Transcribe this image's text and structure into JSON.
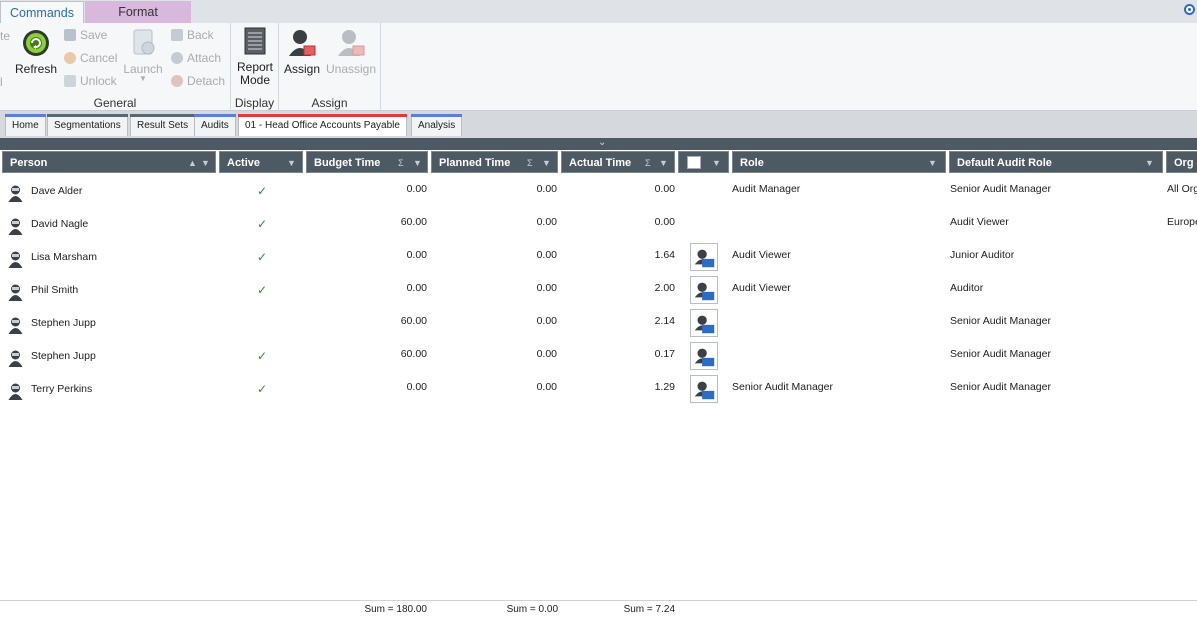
{
  "ribbon": {
    "tabs": [
      "Commands",
      "Format"
    ],
    "general": {
      "label": "General",
      "partial_left_top": "te",
      "partial_left_bottom": "l",
      "refresh": "Refresh",
      "save": "Save",
      "cancel": "Cancel",
      "unlock": "Unlock",
      "launch": "Launch",
      "back": "Back",
      "attach": "Attach",
      "detach": "Detach"
    },
    "display": {
      "label": "Display",
      "report_mode_1": "Report",
      "report_mode_2": "Mode"
    },
    "assign": {
      "label": "Assign",
      "assign": "Assign",
      "unassign": "Unassign"
    }
  },
  "doc_tabs": [
    {
      "label": "Home",
      "bar_color": "#5b7fd6"
    },
    {
      "label": "Segmentations",
      "bar_color": "#5a6670"
    },
    {
      "label": "Result Sets",
      "bar_color": "#5a6670"
    },
    {
      "label": "Audits",
      "bar_color": "#5b7fd6"
    },
    {
      "label": "01 - Head Office Accounts Payable",
      "bar_color": "#e03a3a"
    },
    {
      "label": "Analysis",
      "bar_color": "#5b7fd6"
    }
  ],
  "columns": {
    "person": "Person",
    "active": "Active",
    "budget_time": "Budget Time",
    "planned_time": "Planned Time",
    "actual_time": "Actual Time",
    "role": "Role",
    "default_audit_role": "Default Audit Role",
    "org_unit": "Org U"
  },
  "rows": [
    {
      "person": "Dave Alder",
      "active": true,
      "budget": "0.00",
      "planned": "0.00",
      "actual": "0.00",
      "has_icon": false,
      "role": "Audit Manager",
      "default_role": "Senior Audit Manager",
      "org": "All Org"
    },
    {
      "person": "David Nagle",
      "active": true,
      "budget": "60.00",
      "planned": "0.00",
      "actual": "0.00",
      "has_icon": false,
      "role": "",
      "default_role": "Audit Viewer",
      "org": "Europe"
    },
    {
      "person": "Lisa Marsham",
      "active": true,
      "budget": "0.00",
      "planned": "0.00",
      "actual": "1.64",
      "has_icon": true,
      "role": "Audit Viewer",
      "default_role": "Junior Auditor",
      "org": ""
    },
    {
      "person": "Phil Smith",
      "active": true,
      "budget": "0.00",
      "planned": "0.00",
      "actual": "2.00",
      "has_icon": true,
      "role": "Audit Viewer",
      "default_role": "Auditor",
      "org": ""
    },
    {
      "person": "Stephen Jupp",
      "active": false,
      "budget": "60.00",
      "planned": "0.00",
      "actual": "2.14",
      "has_icon": true,
      "role": "",
      "default_role": "Senior Audit Manager",
      "org": ""
    },
    {
      "person": "Stephen Jupp",
      "active": true,
      "budget": "60.00",
      "planned": "0.00",
      "actual": "0.17",
      "has_icon": true,
      "role": "",
      "default_role": "Senior Audit Manager",
      "org": ""
    },
    {
      "person": "Terry Perkins",
      "active": true,
      "budget": "0.00",
      "planned": "0.00",
      "actual": "1.29",
      "has_icon": true,
      "role": "Senior Audit Manager",
      "default_role": "Senior Audit Manager",
      "org": ""
    }
  ],
  "sums": {
    "budget": "Sum = 180.00",
    "planned": "Sum = 0.00",
    "actual": "Sum = 7.24"
  },
  "icons": {
    "check": "✓",
    "sigma": "Σ",
    "filter": "▼",
    "sort_asc": "▲",
    "expand": "⌄"
  }
}
